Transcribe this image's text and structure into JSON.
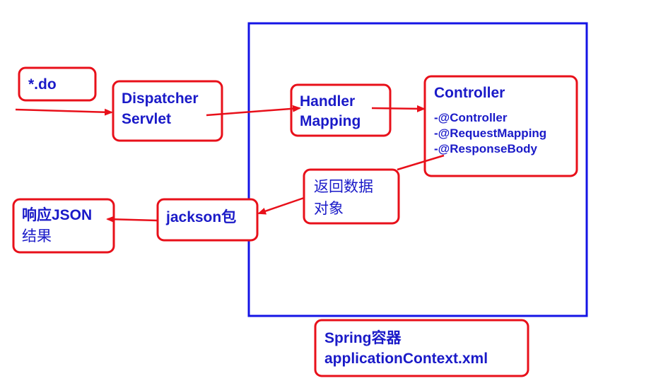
{
  "colors": {
    "text": "#1a1ac8",
    "box_border": "#e8101a",
    "container_border": "#1414e6",
    "arrow": "#e8101a"
  },
  "nodes": {
    "do_request": {
      "line1": "*.do"
    },
    "dispatcher": {
      "line1": "Dispatcher",
      "line2": "Servlet"
    },
    "handler_mapping": {
      "line1": "Handler",
      "line2": "Mapping"
    },
    "controller": {
      "title": "Controller",
      "annotations": [
        "-@Controller",
        "-@RequestMapping",
        "-@ResponseBody"
      ]
    },
    "return_object": {
      "line1": "返回数据",
      "line2": "对象"
    },
    "jackson": {
      "line1": "jackson包"
    },
    "response": {
      "line1": "响应JSON",
      "line2": "结果"
    },
    "spring_container": {
      "line1": "Spring容器",
      "line2": "applicationContext.xml"
    }
  }
}
